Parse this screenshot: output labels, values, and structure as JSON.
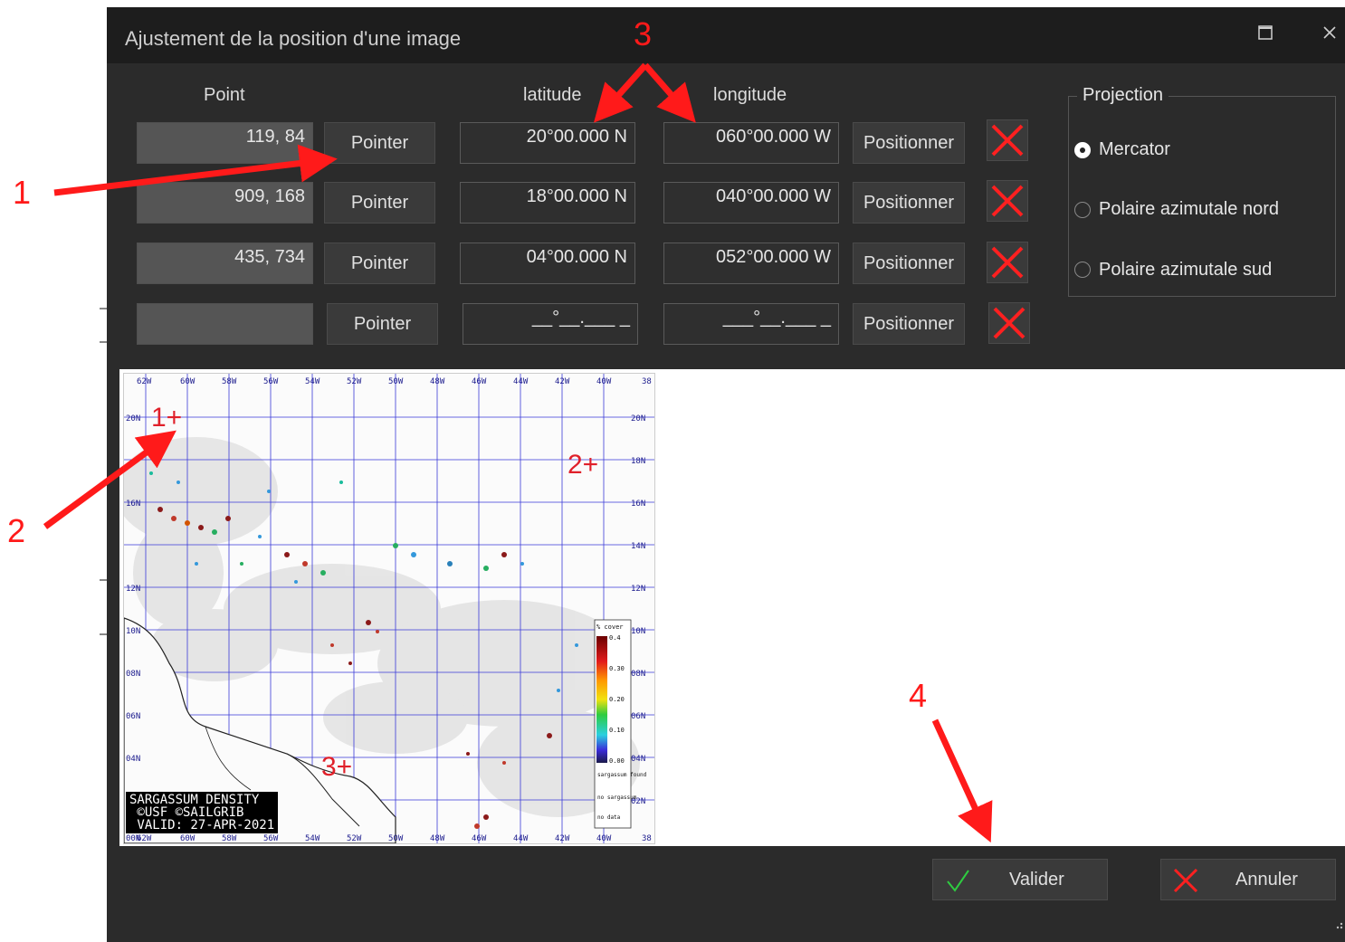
{
  "window": {
    "title": "Ajustement de la position d'une image",
    "maximize_icon": "maximize-icon",
    "close_icon": "close-icon"
  },
  "headers": {
    "point": "Point",
    "latitude": "latitude",
    "longitude": "longitude"
  },
  "rows": [
    {
      "point": "119, 84",
      "latitude": "20°00.000 N",
      "longitude": "060°00.000 W",
      "pointer": "Pointer",
      "position": "Positionner"
    },
    {
      "point": "909, 168",
      "latitude": "18°00.000 N",
      "longitude": "040°00.000 W",
      "pointer": "Pointer",
      "position": "Positionner"
    },
    {
      "point": "435, 734",
      "latitude": "04°00.000 N",
      "longitude": "052°00.000 W",
      "pointer": "Pointer",
      "position": "Positionner"
    },
    {
      "point": "",
      "latitude": "__°__.___ _",
      "longitude": "___°__.___ _",
      "pointer": "Pointer",
      "position": "Positionner"
    }
  ],
  "projection": {
    "label": "Projection",
    "options": [
      "Mercator",
      "Polaire azimutale nord",
      "Polaire azimutale sud"
    ],
    "selected": "Mercator"
  },
  "map": {
    "top_labels": [
      "62W",
      "60W",
      "58W",
      "56W",
      "54W",
      "52W",
      "50W",
      "48W",
      "46W",
      "44W",
      "42W",
      "40W",
      "38"
    ],
    "bottom_labels": [
      "62W",
      "60W",
      "58W",
      "56W",
      "54W",
      "52W",
      "50W",
      "48W",
      "46W",
      "44W",
      "42W",
      "40W",
      "38"
    ],
    "right_labels": [
      "20N",
      "18N",
      "16N",
      "14N",
      "12N",
      "10N",
      "08N",
      "06N",
      "04N",
      "02N",
      "00N"
    ],
    "left_labels": [
      "20N",
      "18N",
      "16N",
      "14N",
      "12N",
      "10N",
      "08N",
      "06N",
      "04N",
      "02N",
      "00N"
    ],
    "caption": [
      "SARGASSUM DENSITY",
      " ©USF ©SAILGRIB",
      " VALID: 27-APR-2021"
    ],
    "legend": {
      "title": "% cover",
      "ticks": [
        "0.4",
        "0.30",
        "0.20",
        "0.10",
        "0.00"
      ],
      "labels": [
        "sargassum found",
        "no sargassum",
        "no data"
      ]
    },
    "markers": [
      "1+",
      "2+",
      "3+"
    ]
  },
  "buttons": {
    "validate": "Valider",
    "cancel": "Annuler"
  },
  "annotations": [
    "1",
    "2",
    "3",
    "4"
  ],
  "colors": {
    "annotation": "#ff1a1a",
    "dialog_bg": "#2b2b2b",
    "check": "#2ecc40",
    "cross": "#ff2020"
  }
}
